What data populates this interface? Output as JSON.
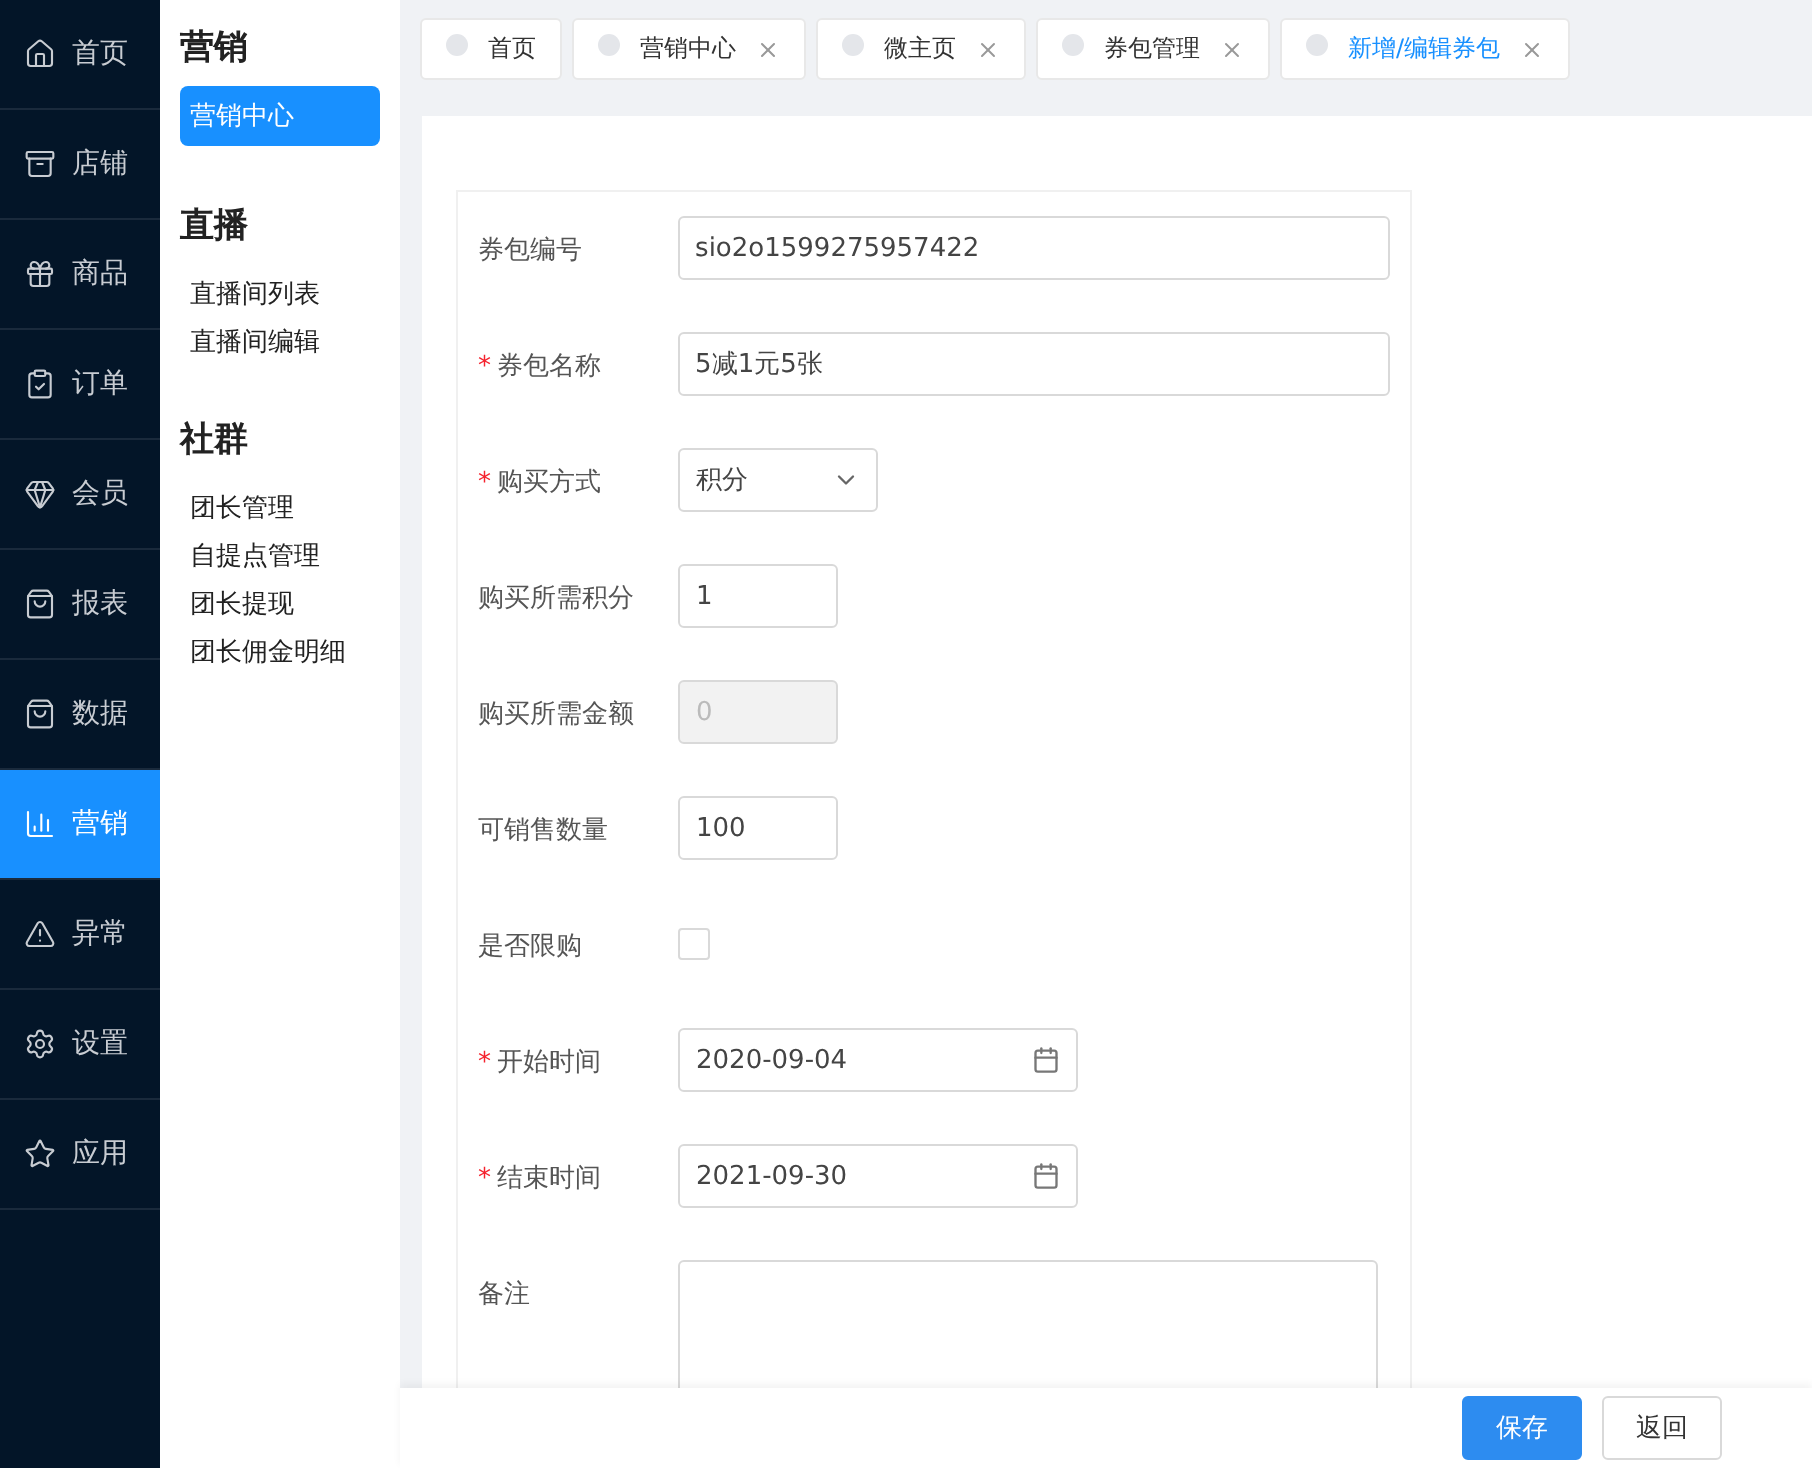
{
  "nav": [
    {
      "label": "首页",
      "selected": false
    },
    {
      "label": "店铺",
      "selected": false
    },
    {
      "label": "商品",
      "selected": false
    },
    {
      "label": "订单",
      "selected": false
    },
    {
      "label": "会员",
      "selected": false
    },
    {
      "label": "报表",
      "selected": false
    },
    {
      "label": "数据",
      "selected": false
    },
    {
      "label": "营销",
      "selected": true
    },
    {
      "label": "异常",
      "selected": false
    },
    {
      "label": "设置",
      "selected": false
    },
    {
      "label": "应用",
      "selected": false
    }
  ],
  "subnav": [
    {
      "title": "营销",
      "items": [
        {
          "label": "营销中心",
          "selected": true
        }
      ]
    },
    {
      "title": "直播",
      "items": [
        {
          "label": "直播间列表",
          "selected": false
        },
        {
          "label": "直播间编辑",
          "selected": false
        }
      ]
    },
    {
      "title": "社群",
      "items": [
        {
          "label": "团长管理",
          "selected": false
        },
        {
          "label": "自提点管理",
          "selected": false
        },
        {
          "label": "团长提现",
          "selected": false
        },
        {
          "label": "团长佣金明细",
          "selected": false
        }
      ]
    }
  ],
  "tabs": [
    {
      "label": "首页",
      "closable": false,
      "selected": false
    },
    {
      "label": "营销中心",
      "closable": true,
      "selected": false
    },
    {
      "label": "微主页",
      "closable": true,
      "selected": false
    },
    {
      "label": "券包管理",
      "closable": true,
      "selected": false
    },
    {
      "label": "新增/编辑券包",
      "closable": true,
      "selected": true
    }
  ],
  "form": [
    {
      "kind": "text",
      "label": "券包编号",
      "value": "sio2o1599275957422"
    },
    {
      "kind": "text",
      "label": "券包名称",
      "required_mark": "*",
      "value": "5减1元5张"
    },
    {
      "kind": "select",
      "label": "购买方式",
      "required_mark": "*",
      "value": "积分"
    },
    {
      "kind": "short",
      "label": "购买所需积分",
      "value": "1",
      "disabled": false
    },
    {
      "kind": "short",
      "label": "购买所需金额",
      "value": "0",
      "disabled": true
    },
    {
      "kind": "short",
      "label": "可销售数量",
      "value": "100",
      "disabled": false
    },
    {
      "kind": "checkbox",
      "label": "是否限购",
      "checked": false
    },
    {
      "kind": "date",
      "label": "开始时间",
      "required_mark": "*",
      "value": "2020-09-04"
    },
    {
      "kind": "date",
      "label": "结束时间",
      "required_mark": "*",
      "value": "2021-09-30"
    },
    {
      "kind": "textarea",
      "label": "备注"
    }
  ],
  "buttons": [
    {
      "label": "保存",
      "kind": "primary"
    },
    {
      "label": "返回",
      "kind": "default"
    }
  ]
}
